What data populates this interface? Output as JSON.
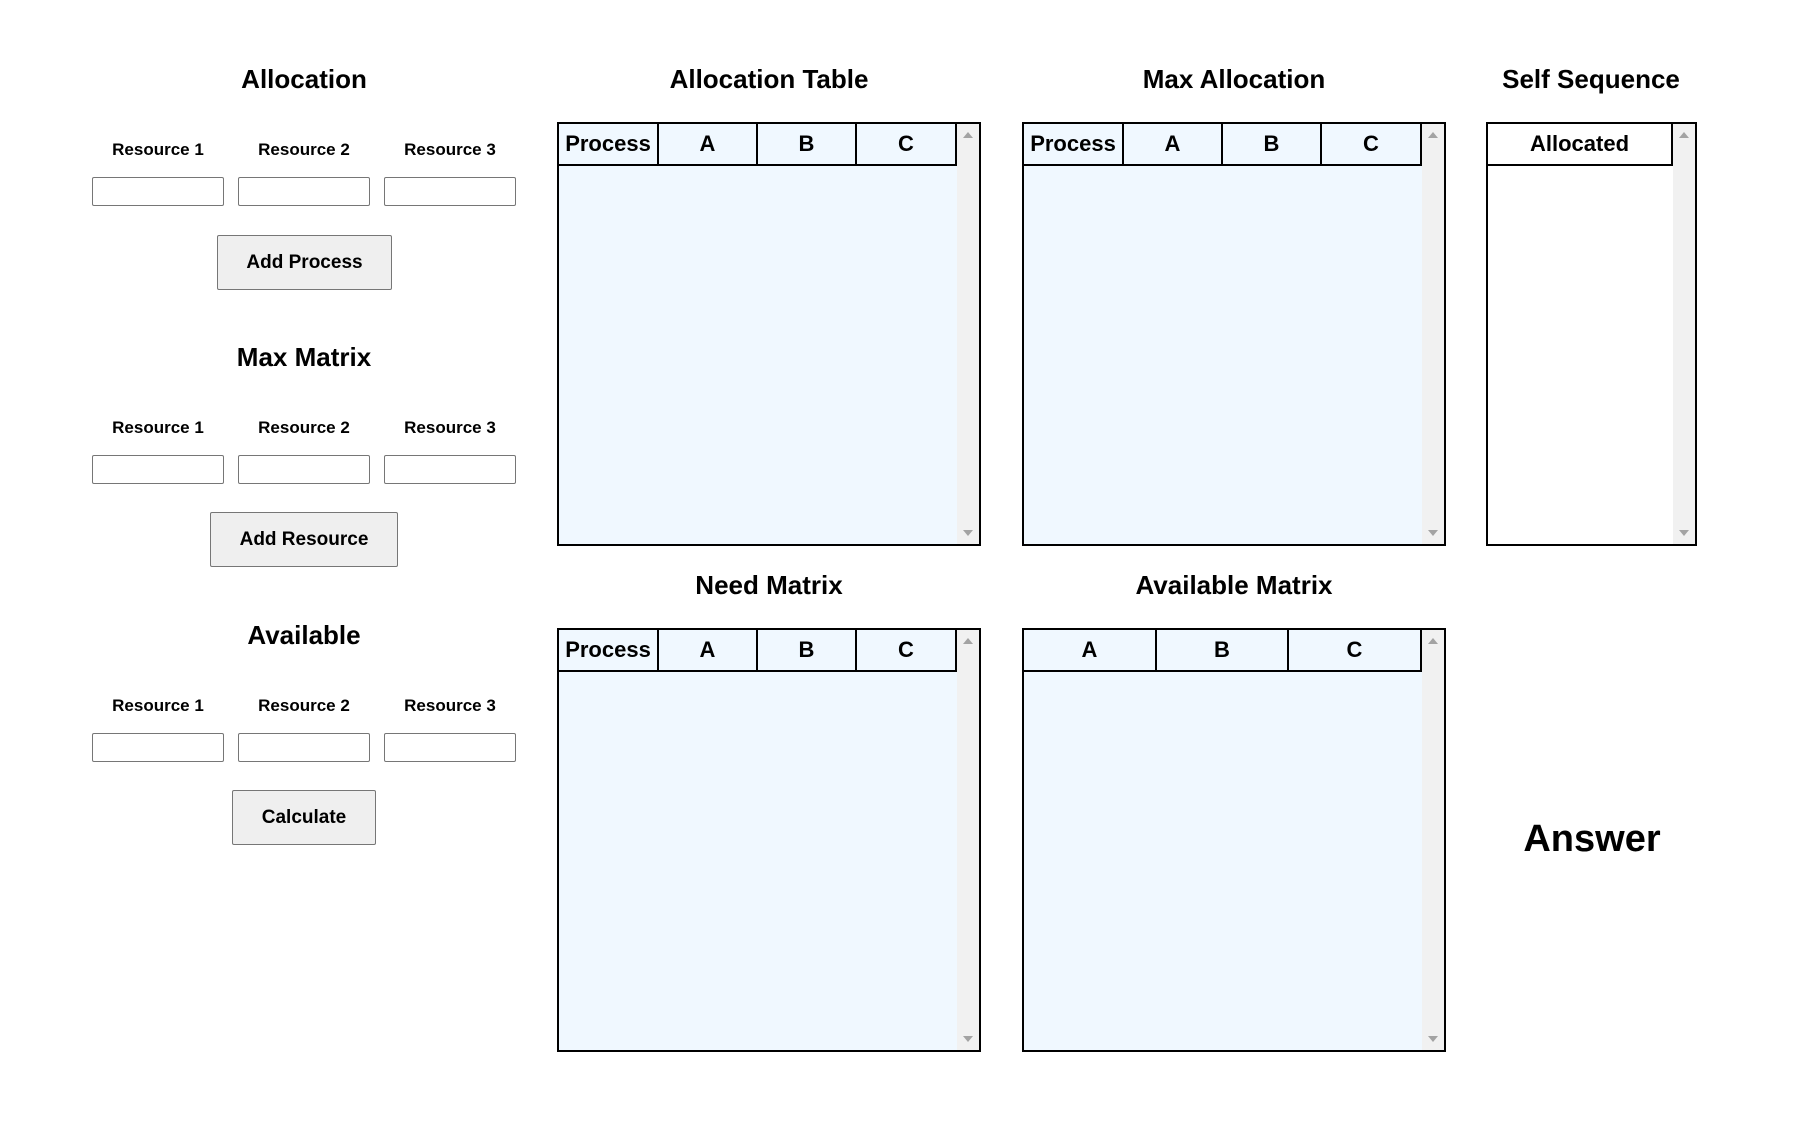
{
  "left": {
    "allocation": {
      "title": "Allocation",
      "labels": [
        "Resource 1",
        "Resource 2",
        "Resource 3"
      ],
      "values": [
        "",
        "",
        ""
      ],
      "button": "Add Process"
    },
    "max_matrix": {
      "title": "Max Matrix",
      "labels": [
        "Resource 1",
        "Resource 2",
        "Resource 3"
      ],
      "values": [
        "",
        "",
        ""
      ],
      "button": "Add Resource"
    },
    "available": {
      "title": "Available",
      "labels": [
        "Resource 1",
        "Resource 2",
        "Resource 3"
      ],
      "values": [
        "",
        "",
        ""
      ],
      "button": "Calculate"
    }
  },
  "tables": {
    "allocation_table": {
      "title": "Allocation Table",
      "headers": [
        "Process",
        "A",
        "B",
        "C"
      ],
      "rows": []
    },
    "max_allocation": {
      "title": "Max Allocation",
      "headers": [
        "Process",
        "A",
        "B",
        "C"
      ],
      "rows": []
    },
    "self_sequence": {
      "title": "Self Sequence",
      "headers": [
        "Allocated"
      ],
      "rows": []
    },
    "need_matrix": {
      "title": "Need Matrix",
      "headers": [
        "Process",
        "A",
        "B",
        "C"
      ],
      "rows": []
    },
    "available_matrix": {
      "title": "Available Matrix",
      "headers": [
        "A",
        "B",
        "C"
      ],
      "rows": []
    }
  },
  "answer": {
    "title": "Answer"
  },
  "colors": {
    "table_background": "#f0f8ff",
    "button_background": "#efefef"
  }
}
